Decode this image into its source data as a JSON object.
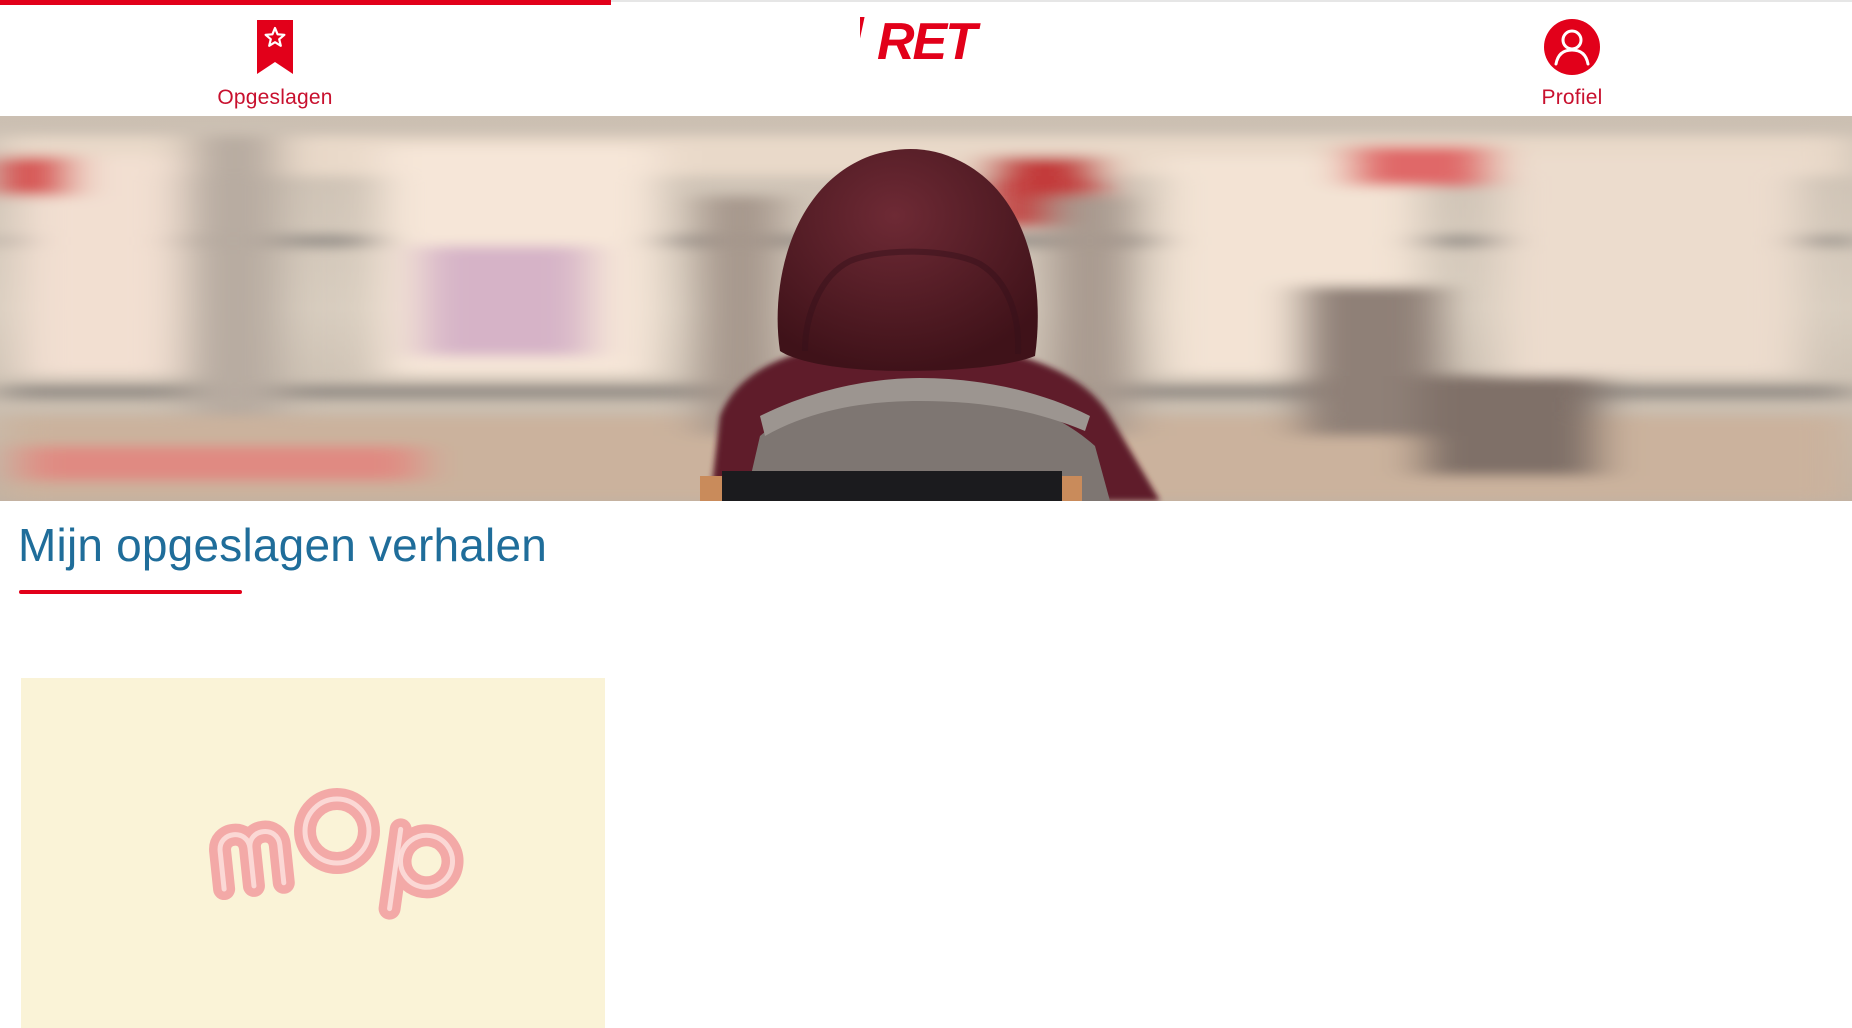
{
  "header": {
    "progress_percent": 33,
    "saved_label": "Opgeslagen",
    "profile_label": "Profiel",
    "logo_text": "RET"
  },
  "colors": {
    "brand_red": "#e2001a",
    "title_blue": "#1f6d9a",
    "card_background": "#faf3d7",
    "card_logo_pink": "#f3a9a7"
  },
  "icons": {
    "saved": "bookmark-star-icon",
    "profile": "user-circle-icon"
  },
  "main": {
    "title": "Mijn opgeslagen verhalen",
    "stories": [
      {
        "thumbnail_text": "mop"
      }
    ]
  }
}
